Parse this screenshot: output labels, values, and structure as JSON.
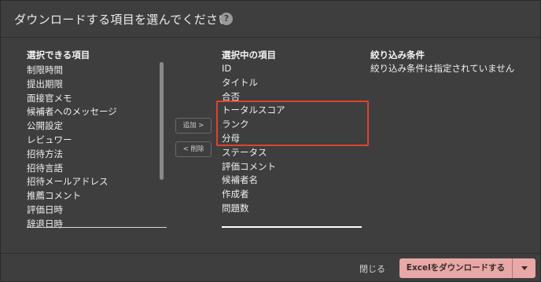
{
  "dialog": {
    "title": "ダウンロードする項目を選んでください",
    "help_icon": "question-circle-icon"
  },
  "available": {
    "heading": "選択できる項目",
    "items": [
      "制限時間",
      "提出期限",
      "面接官メモ",
      "候補者へのメッセージ",
      "公開設定",
      "レビュワー",
      "招待方法",
      "招待言語",
      "招待メールアドレス",
      "推薦コメント",
      "評価日時",
      "辞退日時"
    ]
  },
  "controls": {
    "add_label": "追加 >",
    "remove_label": "< 削除"
  },
  "selected": {
    "heading": "選択中の項目",
    "items": [
      "ID",
      "タイトル",
      "合否",
      "トータルスコア",
      "ランク",
      "分母",
      "ステータス",
      "評価コメント",
      "候補者名",
      "作成者",
      "問題数"
    ]
  },
  "filter": {
    "heading": "絞り込み条件",
    "text": "絞り込み条件は指定されていません"
  },
  "footer": {
    "close_label": "閉じる",
    "excel_label": "Excelをダウンロードする",
    "caret_icon": "caret-down-icon"
  },
  "colors": {
    "highlight": "#e0422f",
    "primary_button": "#e7a8a6"
  }
}
